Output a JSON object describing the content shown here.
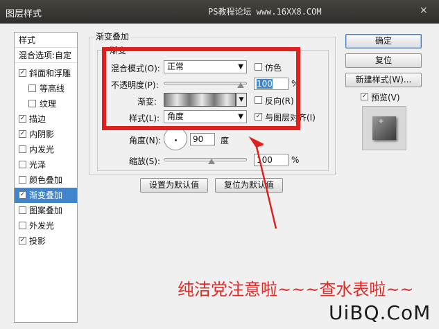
{
  "window": {
    "title": "图层样式",
    "watermark": "PS教程论坛 www.16XX8.COM",
    "close": "×"
  },
  "left_panel": {
    "items": [
      {
        "label": "样式",
        "checked": null,
        "selected": false,
        "indent": 0
      },
      {
        "label": "混合选项:自定",
        "checked": null,
        "selected": false,
        "indent": 0
      },
      {
        "label": "斜面和浮雕",
        "checked": true,
        "selected": false,
        "indent": 0
      },
      {
        "label": "等高线",
        "checked": false,
        "selected": false,
        "indent": 1
      },
      {
        "label": "纹理",
        "checked": false,
        "selected": false,
        "indent": 1
      },
      {
        "label": "描边",
        "checked": true,
        "selected": false,
        "indent": 0
      },
      {
        "label": "内阴影",
        "checked": true,
        "selected": false,
        "indent": 0
      },
      {
        "label": "内发光",
        "checked": false,
        "selected": false,
        "indent": 0
      },
      {
        "label": "光泽",
        "checked": false,
        "selected": false,
        "indent": 0
      },
      {
        "label": "颜色叠加",
        "checked": false,
        "selected": false,
        "indent": 0
      },
      {
        "label": "渐变叠加",
        "checked": true,
        "selected": true,
        "indent": 0
      },
      {
        "label": "图案叠加",
        "checked": false,
        "selected": false,
        "indent": 0
      },
      {
        "label": "外发光",
        "checked": false,
        "selected": false,
        "indent": 0
      },
      {
        "label": "投影",
        "checked": true,
        "selected": false,
        "indent": 0
      }
    ]
  },
  "main": {
    "group_title": "渐变叠加",
    "sub_group_title": "渐变",
    "blend_mode_label": "混合模式(O):",
    "blend_mode_value": "正常",
    "dither_label": "仿色",
    "dither_checked": false,
    "opacity_label": "不透明度(P):",
    "opacity_value": "100",
    "opacity_unit": "%",
    "gradient_label": "渐变:",
    "reverse_label": "反向(R)",
    "reverse_checked": false,
    "style_label": "样式(L):",
    "style_value": "角度",
    "align_label": "与图层对齐(I)",
    "align_checked": true,
    "angle_label": "角度(N):",
    "angle_value": "90",
    "angle_unit": "度",
    "scale_label": "缩放(S):",
    "scale_value": "100",
    "scale_unit": "%",
    "set_default_button": "设置为默认值",
    "reset_default_button": "复位为默认值"
  },
  "right_panel": {
    "ok_button": "确定",
    "reset_button": "复位",
    "new_style_button": "新建样式(W)...",
    "preview_label": "预览(V)",
    "preview_checked": true
  },
  "annotation": {
    "text": "纯洁党注意啦~~~查水表啦~~",
    "brand": "UiBQ.CoM"
  },
  "colors": {
    "highlight_red": "#e0201e",
    "selection_blue": "#3f86ce"
  }
}
